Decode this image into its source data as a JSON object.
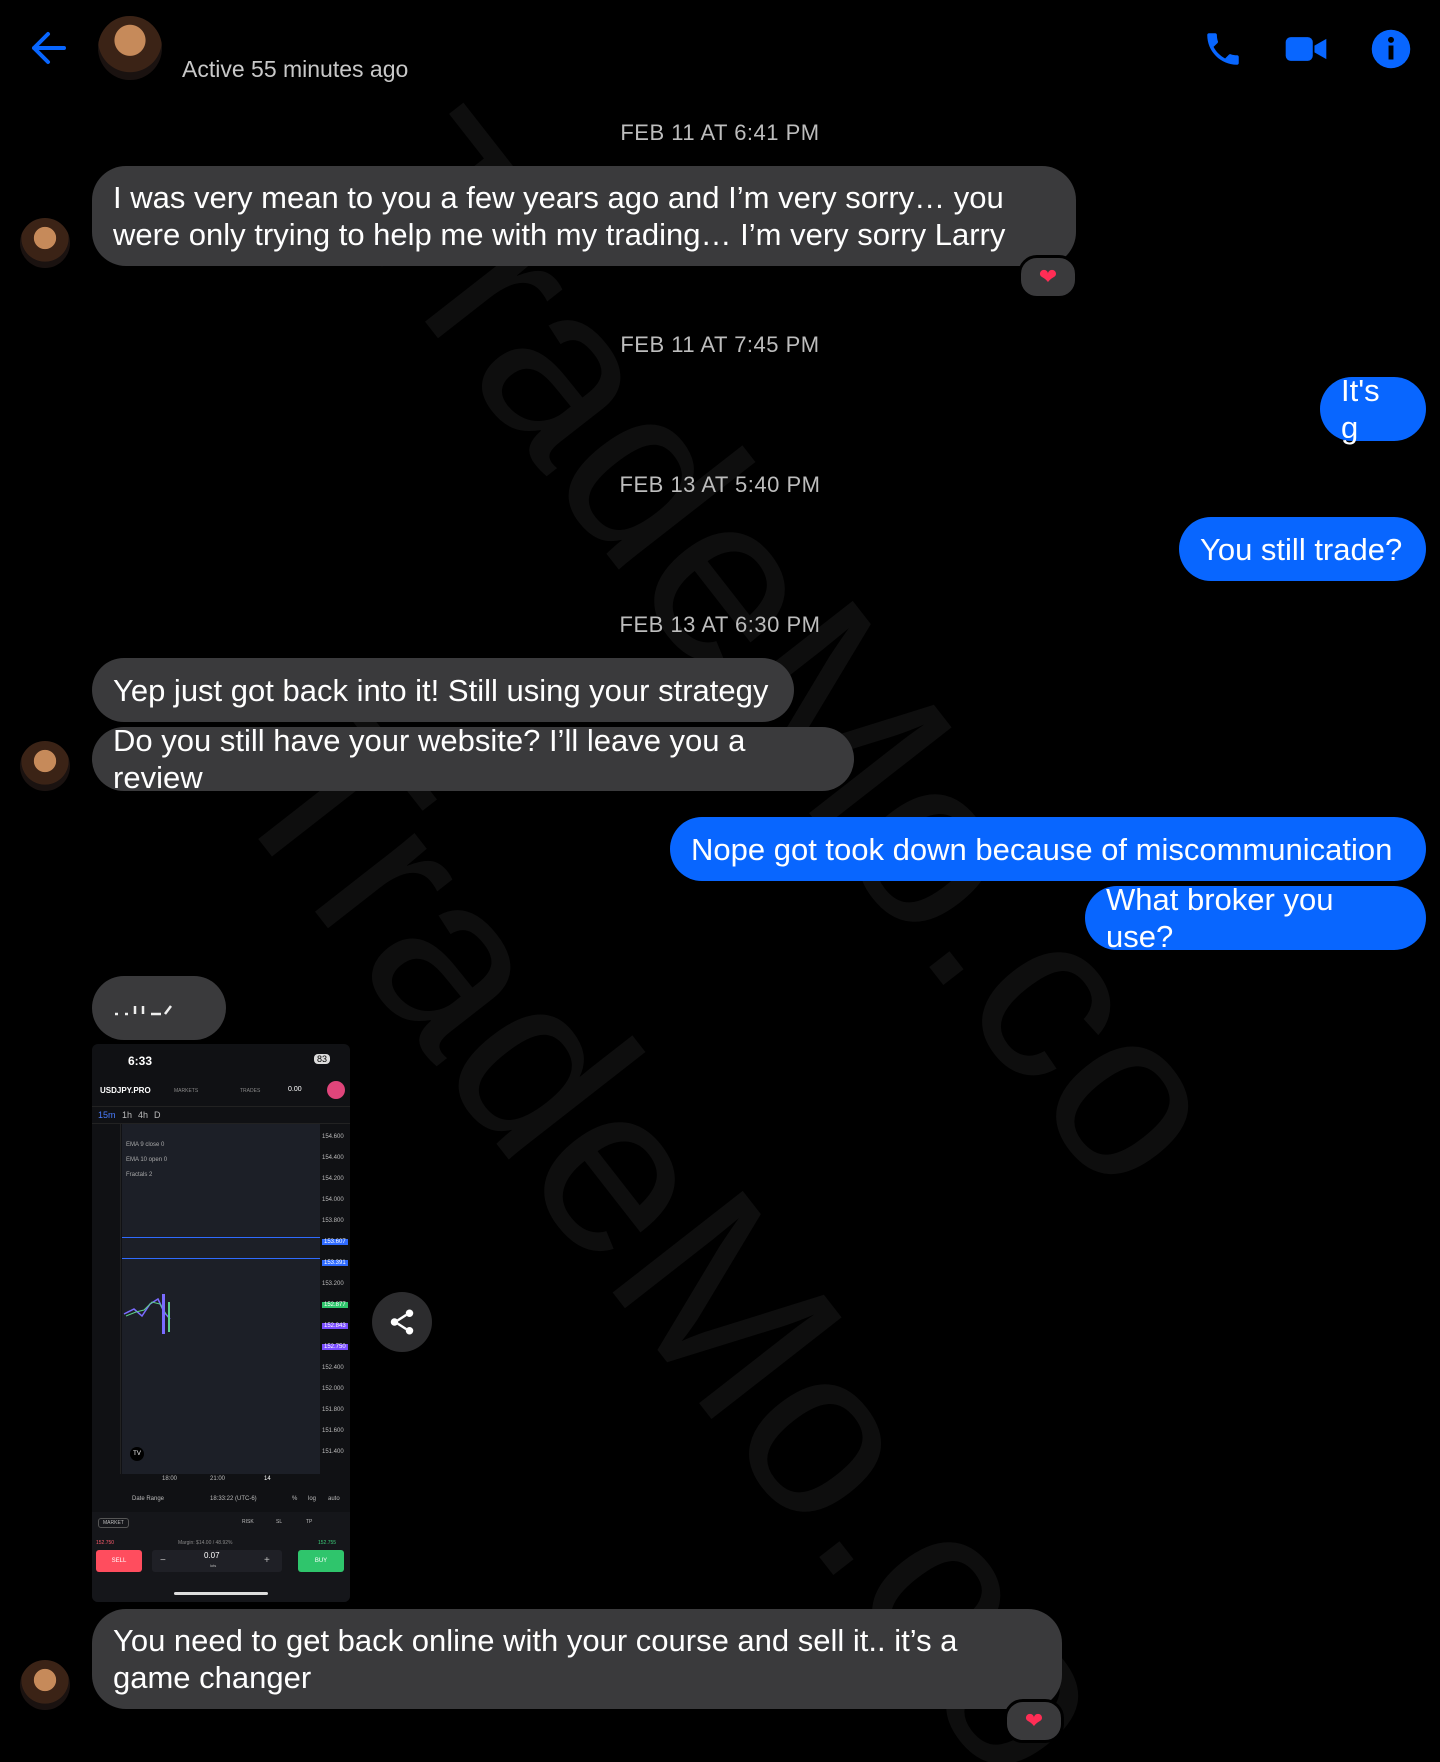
{
  "header": {
    "status": "Active 55 minutes ago"
  },
  "timestamps": [
    "FEB 11 AT 6:41 PM",
    "FEB 11 AT 7:45 PM",
    "FEB 13 AT 5:40 PM",
    "FEB 13 AT 6:30 PM"
  ],
  "messages": [
    {
      "text": "I was very mean to you a few years ago and I’m very sorry… you were only trying to help me with my trading… I’m very sorry Larry",
      "reaction": "heart"
    },
    {
      "text": "It's g"
    },
    {
      "text": "You still trade?"
    },
    {
      "text": "Yep just got back into it! Still using your strategy"
    },
    {
      "text": "Do you still have your website? I’ll leave you a review"
    },
    {
      "text": "Nope got took down because of miscommunication"
    },
    {
      "text": "What broker you use?"
    },
    {
      "text": "You need to get back online with your course and sell it.. it’s a game changer",
      "reaction": "heart"
    }
  ],
  "screenshot": {
    "time": "6:33",
    "battery": "83",
    "symbol": "USDJPY.PRO",
    "tabs": [
      "MARKETS",
      "TRADES"
    ],
    "pnl": "0.00",
    "timeframes": [
      "15m",
      "1h",
      "4h",
      "D"
    ],
    "indicators": [
      "EMA 9 close 0",
      "EMA 10 open 0",
      "Fractals 2"
    ],
    "price_ticks": [
      "154.600",
      "154.400",
      "154.200",
      "154.000",
      "153.800",
      "153.607",
      "153.391",
      "153.200",
      "152.877",
      "152.843",
      "152.750",
      "152.400",
      "152.000",
      "151.800",
      "151.600",
      "151.400"
    ],
    "time_ticks": [
      "18:00",
      "21:00",
      "14"
    ],
    "footer": {
      "date_range": "Date Range",
      "clock": "18:33:22 (UTC-6)",
      "pct": "%",
      "log": "log",
      "auto": "auto"
    },
    "order": {
      "type": "MARKET",
      "tabs": [
        "RISK",
        "SL",
        "TP"
      ],
      "sell_price": "152.750",
      "buy_price": "152.755",
      "margin": "Margin: $14.00 / 48.92%",
      "sell": "SELL",
      "buy": "BUY",
      "lots": "0.07",
      "lots_label": "lots"
    }
  },
  "watermark": "TradeMo.co",
  "colors": {
    "accent": "#0866ff",
    "received": "#3a3a3c",
    "heart": "#ff2d55"
  }
}
